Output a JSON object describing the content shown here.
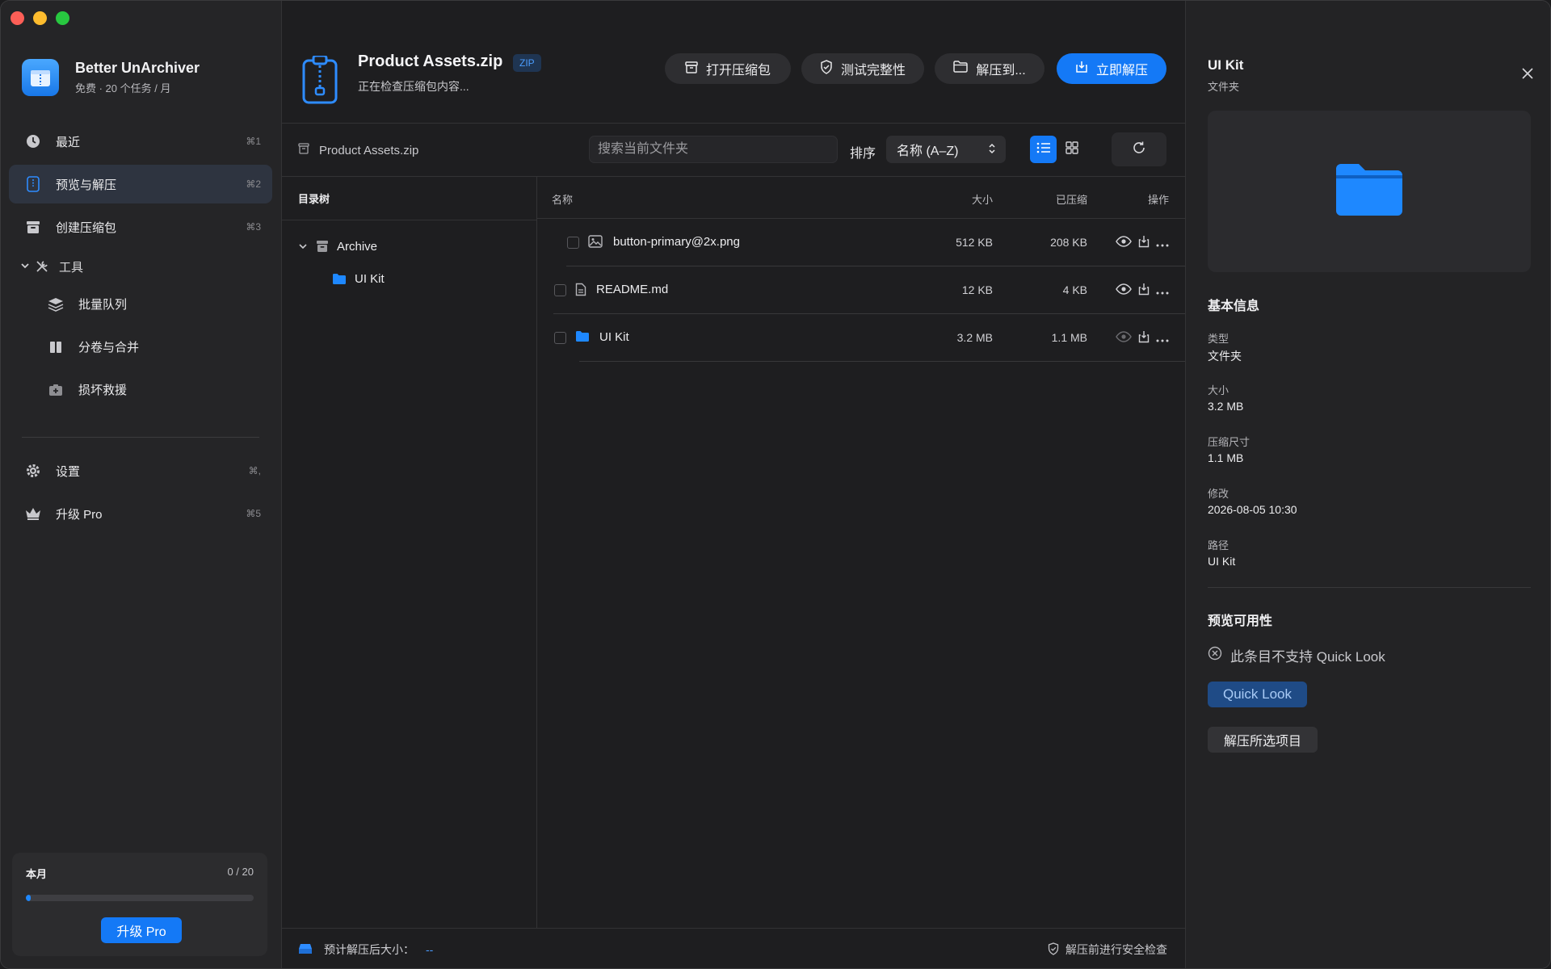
{
  "app": {
    "name": "Better UnArchiver",
    "plan": "免费 · 20 个任务 / 月"
  },
  "sidebar": {
    "items": [
      {
        "label": "最近",
        "shortcut": "⌘1",
        "icon": "clock-icon"
      },
      {
        "label": "预览与解压",
        "shortcut": "⌘2",
        "icon": "zip-file-icon",
        "active": true
      },
      {
        "label": "创建压缩包",
        "shortcut": "⌘3",
        "icon": "archive-box-icon"
      }
    ],
    "tools_group": "工具",
    "tools": [
      {
        "label": "批量队列",
        "icon": "layers-icon"
      },
      {
        "label": "分卷与合并",
        "icon": "split-volume-icon"
      },
      {
        "label": "损坏救援",
        "icon": "first-aid-icon"
      }
    ],
    "bottom_items": [
      {
        "label": "设置",
        "shortcut": "⌘,",
        "icon": "gear-icon"
      },
      {
        "label": "升级 Pro",
        "shortcut": "⌘5",
        "icon": "crown-icon"
      }
    ],
    "usage": {
      "label": "本月",
      "count": "0 / 20",
      "progress": 0.02,
      "upgrade_button": "升级 Pro"
    }
  },
  "header": {
    "archive_name": "Product Assets.zip",
    "badge": "ZIP",
    "status": "正在检查压缩包内容...",
    "buttons": {
      "open": "打开压缩包",
      "test": "测试完整性",
      "extract_to": "解压到...",
      "extract_now": "立即解压"
    }
  },
  "toolbar": {
    "breadcrumb": "Product Assets.zip",
    "search_placeholder": "搜索当前文件夹",
    "sort_label": "排序",
    "sort_value": "名称 (A–Z)"
  },
  "tree": {
    "title": "目录树",
    "root": "Archive",
    "children": [
      "UI Kit"
    ]
  },
  "list": {
    "columns": {
      "name": "名称",
      "size": "大小",
      "compressed": "已压缩",
      "actions": "操作"
    },
    "rows": [
      {
        "name": "button-primary@2x.png",
        "size": "512 KB",
        "compressed": "208 KB",
        "type": "image"
      },
      {
        "name": "README.md",
        "size": "12 KB",
        "compressed": "4 KB",
        "type": "document"
      },
      {
        "name": "UI Kit",
        "size": "3.2 MB",
        "compressed": "1.1 MB",
        "type": "folder"
      }
    ]
  },
  "statusbar": {
    "estimate_label": "预计解压后大小：",
    "estimate_value": "--",
    "safety": "解压前进行安全检查"
  },
  "inspector": {
    "title": "UI Kit",
    "subtitle": "文件夹",
    "basic_info_heading": "基本信息",
    "fields": [
      {
        "key": "类型",
        "value": "文件夹"
      },
      {
        "key": "大小",
        "value": "3.2 MB"
      },
      {
        "key": "压缩尺寸",
        "value": "1.1 MB"
      },
      {
        "key": "修改",
        "value": "2026-08-05 10:30"
      },
      {
        "key": "路径",
        "value": "UI Kit"
      }
    ],
    "preview_heading": "预览可用性",
    "quicklook_note": "此条目不支持 Quick Look",
    "quicklook_button": "Quick Look",
    "extract_selected_button": "解压所选项目"
  },
  "colors": {
    "accent": "#1479f6",
    "folder": "#1e88ff",
    "background": "#1e1e20"
  }
}
